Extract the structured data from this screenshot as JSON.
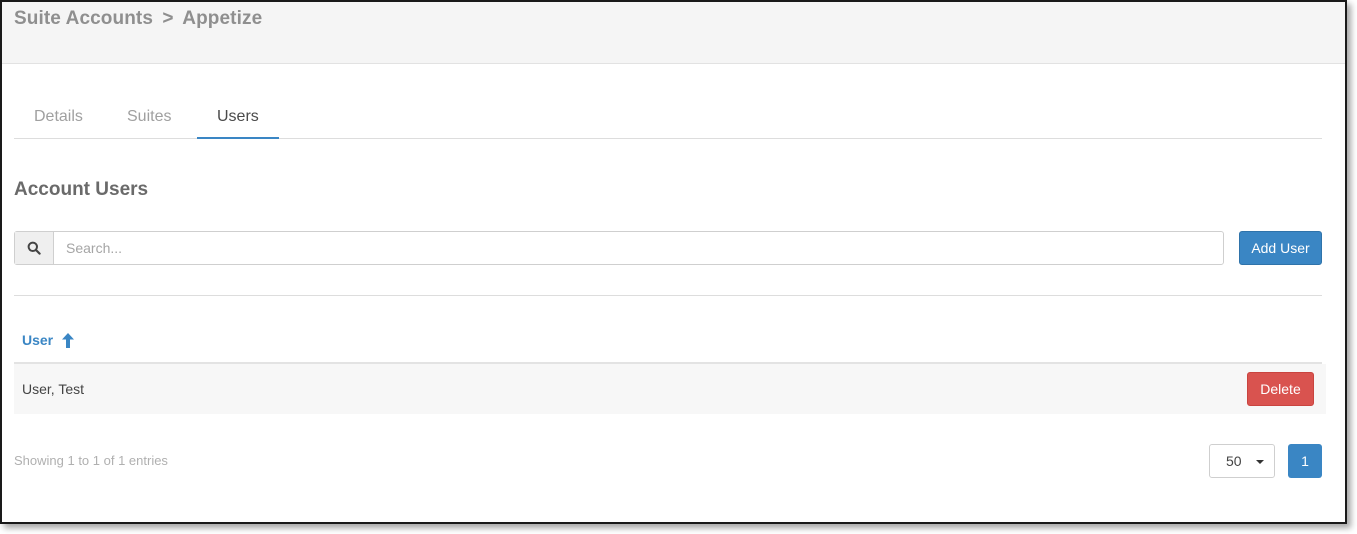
{
  "header": {
    "breadcrumb_parent": "Suite Accounts",
    "breadcrumb_separator": ">",
    "breadcrumb_current": "Appetize"
  },
  "tabs": [
    {
      "label": "Details",
      "active": false
    },
    {
      "label": "Suites",
      "active": false
    },
    {
      "label": "Users",
      "active": true
    }
  ],
  "section": {
    "title": "Account Users"
  },
  "search": {
    "icon": "search-icon",
    "value": "",
    "placeholder": "Search..."
  },
  "toolbar": {
    "add_user_label": "Add User"
  },
  "table": {
    "columns": [
      {
        "label": "User",
        "sort": "ascending",
        "sort_icon": "arrow-up-icon"
      }
    ],
    "rows": [
      {
        "user": "User, Test",
        "action_label": "Delete"
      }
    ]
  },
  "footer": {
    "info": "Showing 1 to 1 of 1 entries",
    "page_size": "50",
    "current_page": "1"
  },
  "colors": {
    "primary": "#3a86c4",
    "danger": "#d9534f",
    "header_bg": "#f5f5f5",
    "row_bg": "#f7f7f7"
  }
}
